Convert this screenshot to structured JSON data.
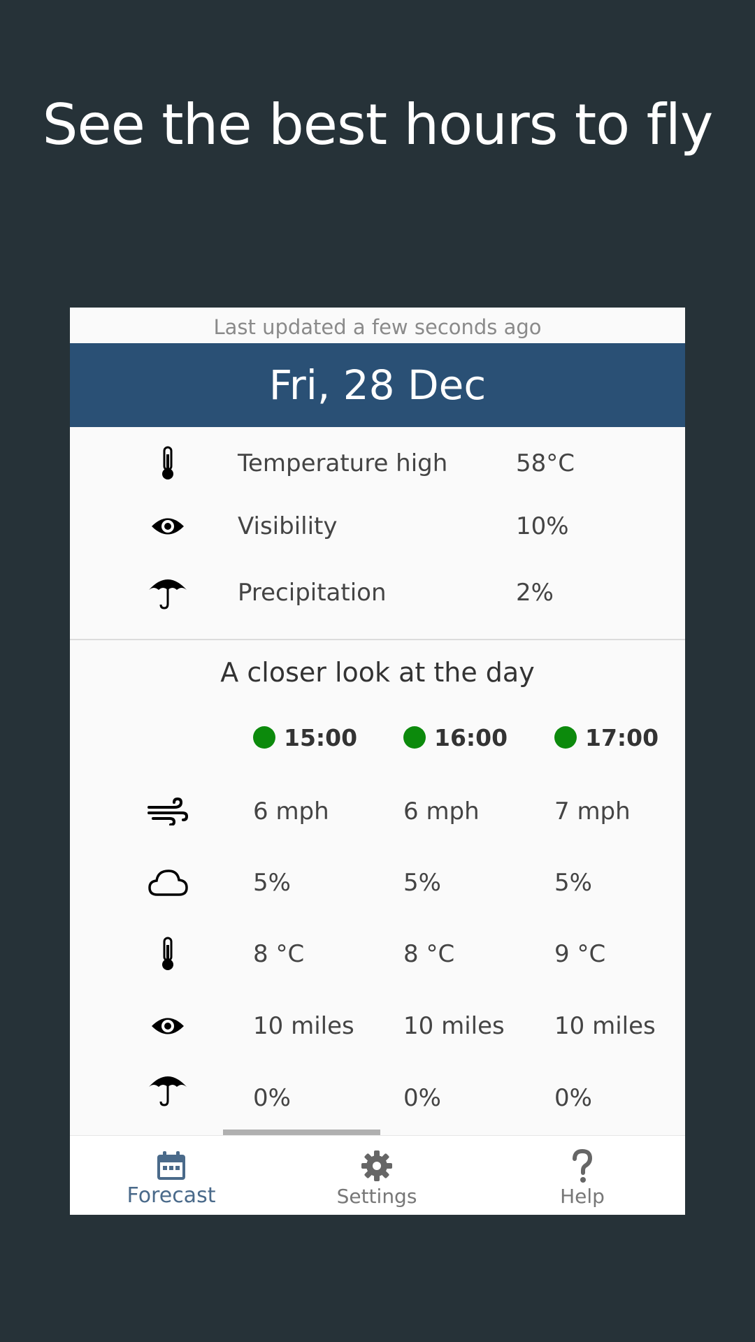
{
  "headline": "See the best hours to fly",
  "last_updated": "Last updated a few seconds ago",
  "date": "Fri, 28 Dec",
  "summary": [
    {
      "icon": "thermometer-icon",
      "label": "Temperature high",
      "value": "58°C"
    },
    {
      "icon": "eye-icon",
      "label": "Visibility",
      "value": "10%"
    },
    {
      "icon": "umbrella-icon",
      "label": "Precipitation",
      "value": "2%"
    }
  ],
  "closer_title": "A closer look at the day",
  "hours": [
    {
      "time": "15:00",
      "status_color": "#0c8a0c"
    },
    {
      "time": "16:00",
      "status_color": "#0c8a0c"
    },
    {
      "time": "17:00",
      "status_color": "#0c8a0c"
    }
  ],
  "details": [
    {
      "icon": "wind-icon",
      "values": [
        "6 mph",
        "6 mph",
        "7 mph"
      ]
    },
    {
      "icon": "cloud-icon",
      "values": [
        "5%",
        "5%",
        "5%"
      ]
    },
    {
      "icon": "thermometer-icon",
      "values": [
        "8 °C",
        "8 °C",
        "9 °C"
      ]
    },
    {
      "icon": "eye-icon",
      "values": [
        "10 miles",
        "10 miles",
        "10 miles"
      ]
    },
    {
      "icon": "umbrella-icon",
      "values": [
        "0%",
        "0%",
        "0%"
      ]
    }
  ],
  "nav": {
    "forecast": "Forecast",
    "settings": "Settings",
    "help": "Help"
  },
  "colors": {
    "background": "#263238",
    "date_bar": "#2a5075",
    "good_status": "#0c8a0c",
    "active_nav": "#4a6a8a"
  }
}
